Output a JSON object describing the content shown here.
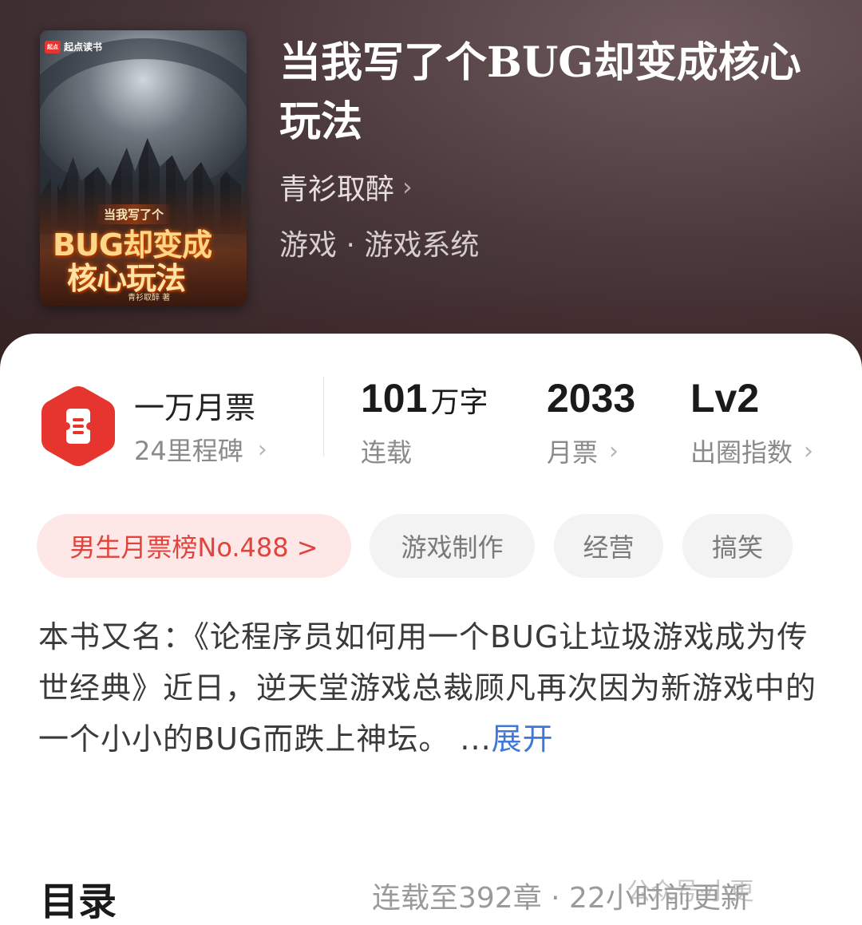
{
  "cover": {
    "brand": "起点读书",
    "brand_badge": "起点",
    "subtitle": "当我写了个",
    "title_line1": "BUG却变成",
    "title_line2": "核心玩法",
    "author": "青衫取醉 著"
  },
  "book": {
    "title": "当我写了个BUG却变成核心玩法",
    "author": "青衫取醉",
    "author_chevron": "›",
    "genre": "游戏 · 游戏系统"
  },
  "stats": {
    "monthly_ticket": {
      "main": "一万月票",
      "sub": "24里程碑"
    },
    "words": {
      "number": "101",
      "unit": "万字",
      "label": "连载"
    },
    "tickets": {
      "number": "2033",
      "label": "月票"
    },
    "influence": {
      "number": "Lv2",
      "label": "出圈指数"
    },
    "chevron": "›"
  },
  "tags": [
    {
      "label": "男生月票榜No.488 >"
    },
    {
      "label": "游戏制作"
    },
    {
      "label": "经营"
    },
    {
      "label": "搞笑"
    }
  ],
  "description": {
    "text": "本书又名：《论程序员如何用一个BUG让垃圾游戏成为传世经典》近日，逆天堂游戏总裁顾凡再次因为新游戏中的一个小小的BUG而跌上神坛。",
    "ellipsis": " ...",
    "expand_label": "展开"
  },
  "toc": {
    "title": "目录",
    "info": "连载至392章 · 22小时前更新",
    "watermark": "公众号·小更"
  },
  "colors": {
    "accent_red": "#e6352e",
    "link_blue": "#3f78d8",
    "tag_primary_bg": "#fde7e7"
  }
}
